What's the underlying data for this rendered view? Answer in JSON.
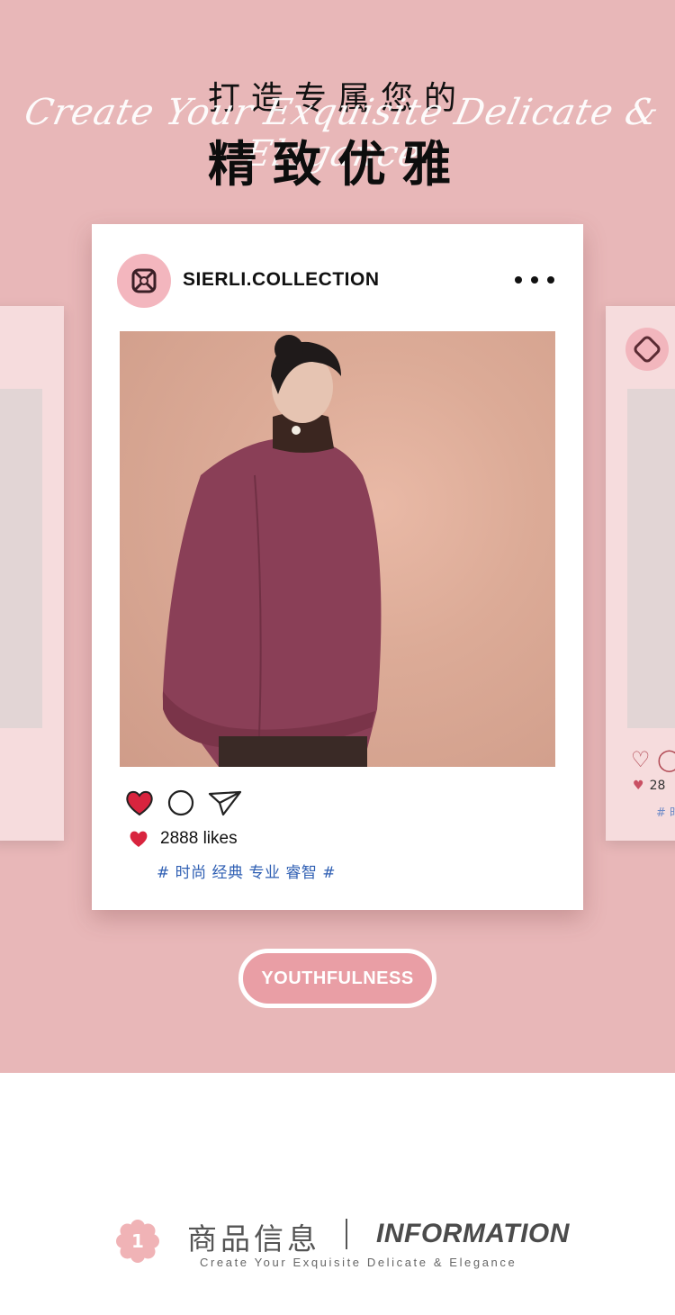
{
  "hero": {
    "script_line": "Create Your Exquisite Delicate & Elegance",
    "headline_small": "打造专属您的",
    "headline_big": "精致优雅",
    "background": "#e8b7b8"
  },
  "post": {
    "username": "SIERLI.COLLECTION",
    "more_icon": "more-dots-icon",
    "likes_count": "2888",
    "likes_word": "likes",
    "tags": "# 时尚 经典 专业 睿智 #",
    "heart_color": "#d8243e",
    "tag_color": "#2f5fb3"
  },
  "side_right": {
    "likes_partial": "28",
    "tag_partial": "# 时"
  },
  "badge": {
    "label": "YOUTHFULNESS",
    "color": "#e99ea5"
  },
  "info": {
    "number": "1",
    "title_cn": "商品信息",
    "title_en": "INFORMATION",
    "subtitle": "Create Your Exquisite Delicate & Elegance",
    "accent": "#f0b3b6"
  }
}
